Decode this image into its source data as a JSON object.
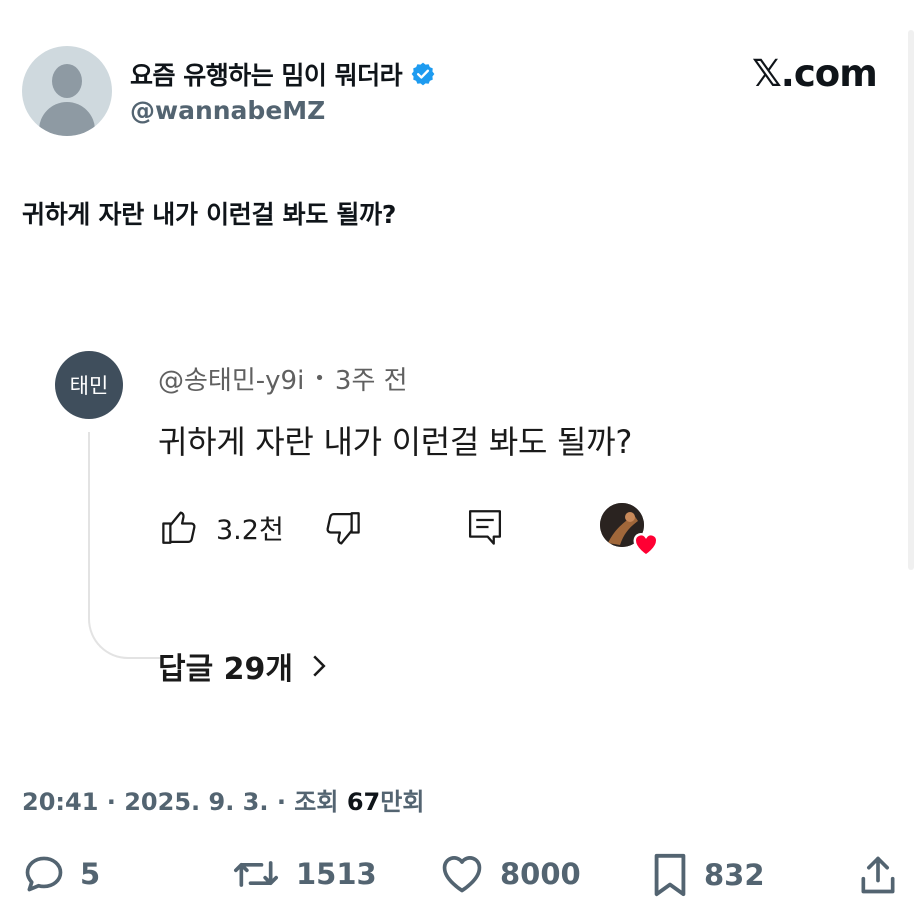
{
  "author": {
    "display_name": "요즘 유행하는 밈이 뭐더라",
    "handle": "@wannabeMZ",
    "verified": true
  },
  "brand": "𝕏.com",
  "tweet": {
    "text": "귀하게 자란 내가 이런걸 봐도 될까?"
  },
  "embedded_comment": {
    "avatar_text": "태민",
    "username": "@송태민-y9i",
    "separator": "•",
    "time": "3주 전",
    "text": "귀하게 자란 내가 이런걸 봐도 될까?",
    "like_count": "3.2천",
    "replies_label": "답글 29개",
    "creator_heart_color": "#ff0033"
  },
  "meta": {
    "time_date": "20:41 · 2025. 9. 3. · 조회 ",
    "views_number": "67",
    "views_unit": "만회"
  },
  "stats": {
    "replies": "5",
    "reposts": "1513",
    "likes": "8000",
    "bookmarks": "832"
  },
  "colors": {
    "verified_blue": "#1d9bf0",
    "secondary_text": "#536471"
  }
}
